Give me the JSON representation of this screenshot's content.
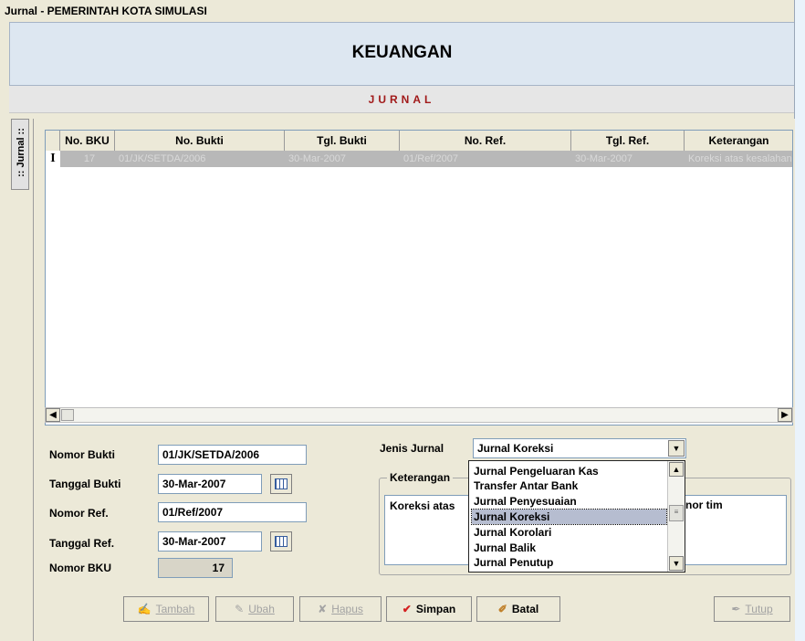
{
  "window": {
    "title": "Jurnal - PEMERINTAH KOTA SIMULASI"
  },
  "header": {
    "title": "KEUANGAN",
    "subtitle": "JURNAL"
  },
  "side_tab": {
    "label": ":: Jurnal ::"
  },
  "grid": {
    "columns": [
      "No. BKU",
      "No. Bukti",
      "Tgl. Bukti",
      "No. Ref.",
      "Tgl. Ref.",
      "Keterangan"
    ],
    "rows": [
      [
        "17",
        "01/JK/SETDA/2006",
        "30-Mar-2007",
        "01/Ref/2007",
        "30-Mar-2007",
        "Koreksi atas kesalahan"
      ]
    ],
    "row_indicator": "I"
  },
  "form": {
    "nomor_bukti": {
      "label": "Nomor Bukti",
      "value": "01/JK/SETDA/2006"
    },
    "tanggal_bukti": {
      "label": "Tanggal Bukti",
      "value": "30-Mar-2007"
    },
    "nomor_ref": {
      "label": "Nomor Ref.",
      "value": "01/Ref/2007"
    },
    "tanggal_ref": {
      "label": "Tanggal Ref.",
      "value": "30-Mar-2007"
    },
    "nomor_bku": {
      "label": "Nomor BKU",
      "value": "17"
    },
    "jenis_jurnal": {
      "label": "Jenis Jurnal",
      "selected": "Jurnal Koreksi",
      "options": [
        "Jurnal Pengeluaran Kas",
        "Transfer Antar Bank",
        "Jurnal Penyesuaian",
        "Jurnal Koreksi",
        "Jurnal Korolari",
        "Jurnal Balik",
        "Jurnal Penutup"
      ]
    },
    "keterangan": {
      "label": "Keterangan",
      "value": "Koreksi atas",
      "visible_tail": "nor tim"
    }
  },
  "buttons": {
    "tambah": "Tambah",
    "ubah": "Ubah",
    "hapus": "Hapus",
    "simpan": "Simpan",
    "batal": "Batal",
    "tutup": "Tutup"
  }
}
